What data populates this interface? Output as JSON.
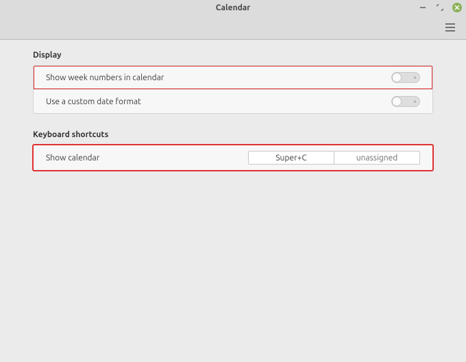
{
  "window": {
    "title": "Calendar"
  },
  "sections": {
    "display": {
      "header": "Display",
      "rows": {
        "week_numbers": {
          "label": "Show week numbers in calendar",
          "state": "off"
        },
        "custom_date": {
          "label": "Use a custom date format",
          "state": "off"
        }
      }
    },
    "shortcuts": {
      "header": "Keyboard shortcuts",
      "rows": {
        "show_calendar": {
          "label": "Show calendar",
          "primary": "Super+C",
          "secondary": "unassigned"
        }
      }
    }
  }
}
